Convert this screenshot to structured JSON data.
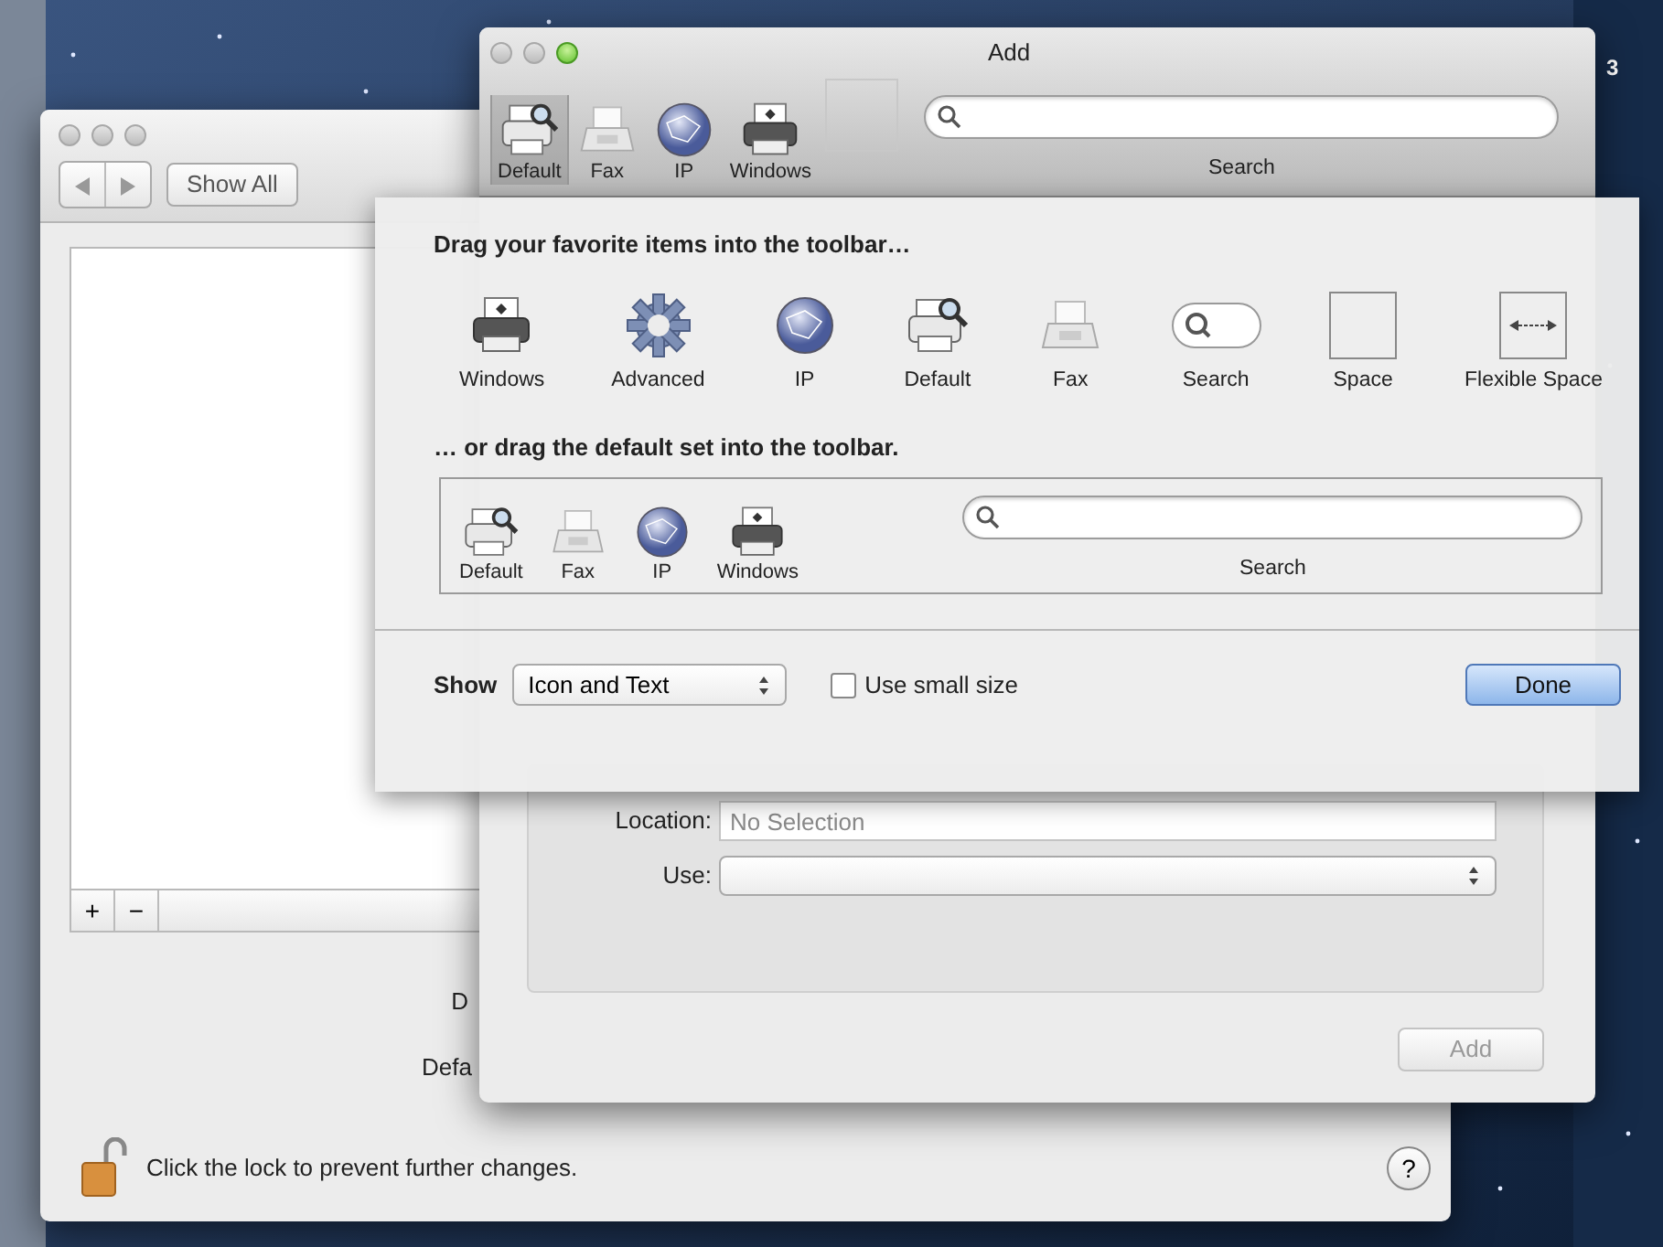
{
  "desktop": {
    "corner_text": "3"
  },
  "back_window": {
    "traffic_lights": [
      {
        "enabled": false
      },
      {
        "enabled": false
      },
      {
        "enabled": false
      }
    ],
    "show_all": "Show All",
    "list_buttons": [
      "+",
      "−"
    ],
    "labels": [
      "D",
      "Defa"
    ],
    "lock_text": "Click the lock to prevent further changes.",
    "help": "?"
  },
  "add_window": {
    "title": "Add",
    "traffic_lights": [
      {
        "enabled": false
      },
      {
        "enabled": false
      },
      {
        "enabled": true
      }
    ],
    "toolbar": [
      {
        "kind": "default",
        "label": "Default",
        "selected": true
      },
      {
        "kind": "fax",
        "label": "Fax",
        "selected": false
      },
      {
        "kind": "ip",
        "label": "IP",
        "selected": false
      },
      {
        "kind": "windows",
        "label": "Windows",
        "selected": false
      },
      {
        "kind": "space"
      },
      {
        "kind": "search",
        "label": "Search"
      }
    ],
    "fields": [
      {
        "kind": "text",
        "label": "Location:",
        "placeholder": "No Selection"
      },
      {
        "kind": "popup",
        "label": "Use:"
      }
    ],
    "add_button": {
      "label": "Add",
      "disabled": true
    }
  },
  "customize_sheet": {
    "heading": "Drag your favorite items into the toolbar…",
    "palette": [
      {
        "kind": "windows",
        "label": "Windows"
      },
      {
        "kind": "advanced",
        "label": "Advanced"
      },
      {
        "kind": "ip",
        "label": "IP"
      },
      {
        "kind": "default",
        "label": "Default"
      },
      {
        "kind": "fax",
        "label": "Fax"
      },
      {
        "kind": "searchpill",
        "label": "Search"
      },
      {
        "kind": "space",
        "label": "Space"
      },
      {
        "kind": "flex",
        "label": "Flexible Space"
      }
    ],
    "default_heading": "… or drag the default set into the toolbar.",
    "default_set": [
      {
        "kind": "default",
        "label": "Default"
      },
      {
        "kind": "fax",
        "label": "Fax"
      },
      {
        "kind": "ip",
        "label": "IP"
      },
      {
        "kind": "windows",
        "label": "Windows"
      },
      {
        "kind": "search",
        "label": "Search"
      }
    ],
    "show_label": "Show",
    "show_value": "Icon and Text",
    "small_size": {
      "label": "Use small size",
      "checked": false
    },
    "done": "Done"
  }
}
